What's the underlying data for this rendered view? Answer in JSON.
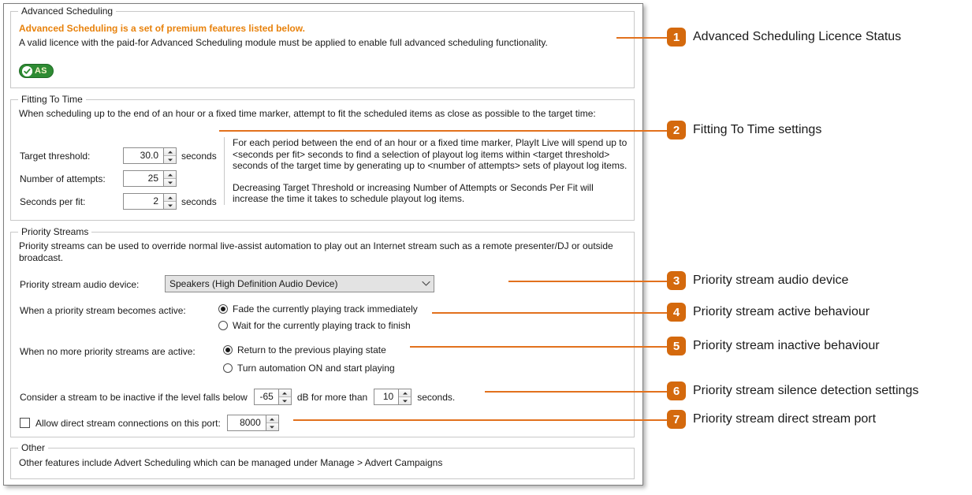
{
  "window": {
    "sections": {
      "advanced_scheduling": {
        "legend": "Advanced Scheduling",
        "headline": "Advanced Scheduling is a set of premium features listed below.",
        "body": "A valid licence with the paid-for Advanced Scheduling module must be applied to enable full advanced scheduling functionality.",
        "badge": {
          "label": "AS",
          "icon": "check-circle-icon",
          "background_color": "#2e8b33",
          "text_color": "#f2f5c8"
        }
      },
      "fitting_to_time": {
        "legend": "Fitting To Time",
        "intro": "When scheduling up to the end of an hour or a fixed time marker, attempt to fit the scheduled items as close as possible to the target time:",
        "fields": [
          {
            "label": "Target threshold:",
            "value": "30.0",
            "unit": "seconds"
          },
          {
            "label": "Number of attempts:",
            "value": "25",
            "unit": ""
          },
          {
            "label": "Seconds per fit:",
            "value": "2",
            "unit": "seconds"
          }
        ],
        "description_paragraphs": [
          "For each period between the end of an hour or a fixed time marker, PlayIt Live will spend up to <seconds per fit> seconds to find a selection of playout log items within <target threshold> seconds of the target time by generating up to <number of attempts> sets of playout log items.",
          "Decreasing Target Threshold or increasing Number of Attempts or Seconds Per Fit will increase the time it takes to schedule playout log items."
        ]
      },
      "priority_streams": {
        "legend": "Priority Streams",
        "intro": "Priority streams can be used to override normal live-assist automation to play out an Internet stream such as a remote presenter/DJ or outside broadcast.",
        "audio_device": {
          "label": "Priority stream audio device:",
          "selected": "Speakers (High Definition Audio Device)",
          "chevron_icon": "chevron-down-icon"
        },
        "active_behaviour": {
          "label": "When a priority stream becomes active:",
          "options": [
            {
              "text": "Fade the currently playing track immediately",
              "selected": true
            },
            {
              "text": "Wait for the currently playing track to finish",
              "selected": false
            }
          ]
        },
        "inactive_behaviour": {
          "label": "When no more priority streams are active:",
          "options": [
            {
              "text": "Return to the previous playing state",
              "selected": true
            },
            {
              "text": "Turn automation ON and start playing",
              "selected": false
            }
          ]
        },
        "silence_detection": {
          "text_before": "Consider a stream to be inactive if the level  falls below",
          "level_value": "-65",
          "text_middle": "dB for more than",
          "seconds_value": "10",
          "text_after": "seconds."
        },
        "direct_stream": {
          "checkbox_checked": false,
          "label": "Allow direct stream connections on this port:",
          "port_value": "8000"
        }
      },
      "other": {
        "legend": "Other",
        "body": "Other features include Advert Scheduling which can be managed under Manage > Advert Campaigns"
      }
    }
  },
  "annotations": {
    "accent_color": "#d4690d",
    "items": [
      {
        "number": "1",
        "title": "Advanced Scheduling Licence Status"
      },
      {
        "number": "2",
        "title": "Fitting To Time settings"
      },
      {
        "number": "3",
        "title": "Priority stream audio device"
      },
      {
        "number": "4",
        "title": "Priority stream active behaviour"
      },
      {
        "number": "5",
        "title": "Priority stream inactive behaviour"
      },
      {
        "number": "6",
        "title": "Priority stream silence detection settings"
      },
      {
        "number": "7",
        "title": "Priority stream direct stream port"
      }
    ]
  }
}
